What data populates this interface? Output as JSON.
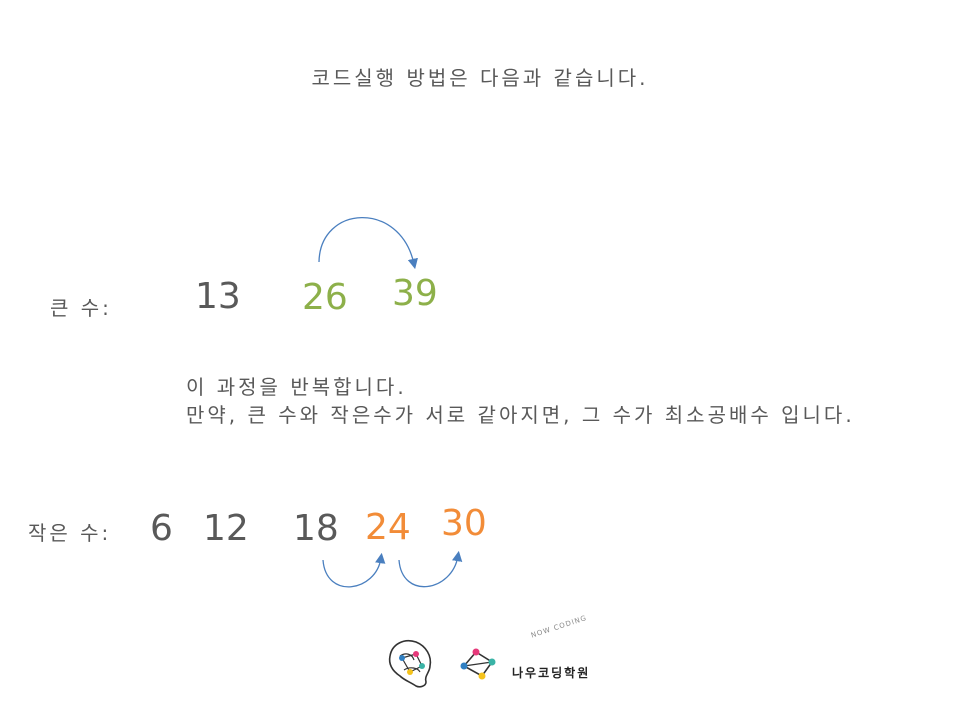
{
  "header": {
    "title": "코드실행 방법은 다음과 같습니다."
  },
  "large_row": {
    "label": "큰 수:",
    "numbers": [
      "13",
      "26",
      "39"
    ]
  },
  "explanation": {
    "line1": "이 과정을 반복합니다.",
    "line2": "만약, 큰 수와 작은수가 서로 같아지면, 그 수가 최소공배수 입니다."
  },
  "small_row": {
    "label": "작은 수:",
    "numbers": [
      "6",
      "12",
      "18",
      "24",
      "30"
    ]
  },
  "logo": {
    "name": "나우코딩학원",
    "tagline": "NOW CODING"
  },
  "colors": {
    "text_gray": "#595959",
    "green": "#8db04a",
    "orange": "#f28c38",
    "arrow_blue": "#4a7fbf"
  }
}
